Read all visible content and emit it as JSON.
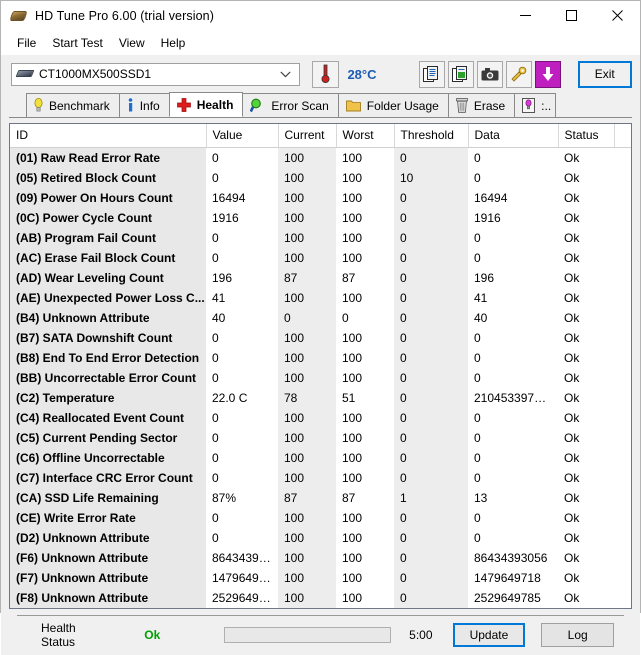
{
  "window": {
    "title": "HD Tune Pro 6.00 (trial version)",
    "icon": "harddisk-icon",
    "minimize": "—",
    "maximize": "□",
    "close": "✕"
  },
  "menu": {
    "items": [
      {
        "label": "File",
        "name": "menu-file"
      },
      {
        "label": "Start Test",
        "name": "menu-start-test"
      },
      {
        "label": "View",
        "name": "menu-view"
      },
      {
        "label": "Help",
        "name": "menu-help"
      }
    ]
  },
  "toolbar": {
    "drive": "CT1000MX500SSD1",
    "drive_icon": "harddisk-icon",
    "dropdown_icon": "chevron-down-icon",
    "temperature": "28°C",
    "temperature_icon": "thermometer-icon",
    "buttons": [
      {
        "name": "copy-icon",
        "title": "Copy"
      },
      {
        "name": "copy-image-icon",
        "title": "Copy image"
      },
      {
        "name": "screenshot-icon",
        "title": "Screenshot"
      },
      {
        "name": "tools-icon",
        "title": "Options"
      },
      {
        "name": "download-icon",
        "title": "Save"
      }
    ],
    "exit_label": "Exit"
  },
  "tabs": [
    {
      "label": "Benchmark",
      "icon": "lightbulb-icon",
      "active": false
    },
    {
      "label": "Info",
      "icon": "info-icon",
      "active": false
    },
    {
      "label": "Health",
      "icon": "red-cross-icon",
      "active": true
    },
    {
      "label": "Error Scan",
      "icon": "magnifier-icon",
      "active": false
    },
    {
      "label": "Folder Usage",
      "icon": "folder-icon",
      "active": false
    },
    {
      "label": "Erase",
      "icon": "trash-icon",
      "active": false
    },
    {
      "label": ":..",
      "icon": "monitor-icon",
      "active": false
    }
  ],
  "table": {
    "columns": [
      "ID",
      "Value",
      "Current",
      "Worst",
      "Threshold",
      "Data",
      "Status"
    ],
    "rows": [
      {
        "id": "(01) Raw Read Error Rate",
        "value": "0",
        "current": "100",
        "worst": "100",
        "threshold": "0",
        "data": "0",
        "status": "Ok"
      },
      {
        "id": "(05) Retired Block Count",
        "value": "0",
        "current": "100",
        "worst": "100",
        "threshold": "10",
        "data": "0",
        "status": "Ok"
      },
      {
        "id": "(09) Power On Hours Count",
        "value": "16494",
        "current": "100",
        "worst": "100",
        "threshold": "0",
        "data": "16494",
        "status": "Ok"
      },
      {
        "id": "(0C) Power Cycle Count",
        "value": "1916",
        "current": "100",
        "worst": "100",
        "threshold": "0",
        "data": "1916",
        "status": "Ok"
      },
      {
        "id": "(AB) Program Fail Count",
        "value": "0",
        "current": "100",
        "worst": "100",
        "threshold": "0",
        "data": "0",
        "status": "Ok"
      },
      {
        "id": "(AC) Erase Fail Block Count",
        "value": "0",
        "current": "100",
        "worst": "100",
        "threshold": "0",
        "data": "0",
        "status": "Ok"
      },
      {
        "id": "(AD) Wear Leveling Count",
        "value": "196",
        "current": "87",
        "worst": "87",
        "threshold": "0",
        "data": "196",
        "status": "Ok"
      },
      {
        "id": "(AE) Unexpected Power Loss C...",
        "value": "41",
        "current": "100",
        "worst": "100",
        "threshold": "0",
        "data": "41",
        "status": "Ok"
      },
      {
        "id": "(B4) Unknown Attribute",
        "value": "40",
        "current": "0",
        "worst": "0",
        "threshold": "0",
        "data": "40",
        "status": "Ok"
      },
      {
        "id": "(B7) SATA Downshift Count",
        "value": "0",
        "current": "100",
        "worst": "100",
        "threshold": "0",
        "data": "0",
        "status": "Ok"
      },
      {
        "id": "(B8) End To End Error Detection",
        "value": "0",
        "current": "100",
        "worst": "100",
        "threshold": "0",
        "data": "0",
        "status": "Ok"
      },
      {
        "id": "(BB) Uncorrectable Error Count",
        "value": "0",
        "current": "100",
        "worst": "100",
        "threshold": "0",
        "data": "0",
        "status": "Ok"
      },
      {
        "id": "(C2) Temperature",
        "value": "22.0 C",
        "current": "78",
        "worst": "51",
        "threshold": "0",
        "data": "210453397…",
        "status": "Ok"
      },
      {
        "id": "(C4) Reallocated Event Count",
        "value": "0",
        "current": "100",
        "worst": "100",
        "threshold": "0",
        "data": "0",
        "status": "Ok"
      },
      {
        "id": "(C5) Current Pending Sector",
        "value": "0",
        "current": "100",
        "worst": "100",
        "threshold": "0",
        "data": "0",
        "status": "Ok"
      },
      {
        "id": "(C6) Offline Uncorrectable",
        "value": "0",
        "current": "100",
        "worst": "100",
        "threshold": "0",
        "data": "0",
        "status": "Ok"
      },
      {
        "id": "(C7) Interface CRC Error Count",
        "value": "0",
        "current": "100",
        "worst": "100",
        "threshold": "0",
        "data": "0",
        "status": "Ok"
      },
      {
        "id": "(CA) SSD Life Remaining",
        "value": "87%",
        "current": "87",
        "worst": "87",
        "threshold": "1",
        "data": "13",
        "status": "Ok"
      },
      {
        "id": "(CE) Write Error Rate",
        "value": "0",
        "current": "100",
        "worst": "100",
        "threshold": "0",
        "data": "0",
        "status": "Ok"
      },
      {
        "id": "(D2) Unknown Attribute",
        "value": "0",
        "current": "100",
        "worst": "100",
        "threshold": "0",
        "data": "0",
        "status": "Ok"
      },
      {
        "id": "(F6) Unknown Attribute",
        "value": "8643439…",
        "current": "100",
        "worst": "100",
        "threshold": "0",
        "data": "86434393056",
        "status": "Ok"
      },
      {
        "id": "(F7) Unknown Attribute",
        "value": "1479649…",
        "current": "100",
        "worst": "100",
        "threshold": "0",
        "data": "1479649718",
        "status": "Ok"
      },
      {
        "id": "(F8) Unknown Attribute",
        "value": "2529649…",
        "current": "100",
        "worst": "100",
        "threshold": "0",
        "data": "2529649785",
        "status": "Ok"
      }
    ]
  },
  "status": {
    "health_label": "Health Status",
    "health_value": "Ok",
    "progress_percent": 0,
    "eta": "5:00",
    "update_label": "Update",
    "log_label": "Log"
  },
  "colors": {
    "accent": "#0078d7",
    "ok_green": "#00a000",
    "temp_blue": "#1b5bb5",
    "window_bg": "#f0f0f0",
    "grid_bg": "#ffffff",
    "id_col_bg": "#e8e8e8",
    "alt_col_bg": "#ededed"
  }
}
